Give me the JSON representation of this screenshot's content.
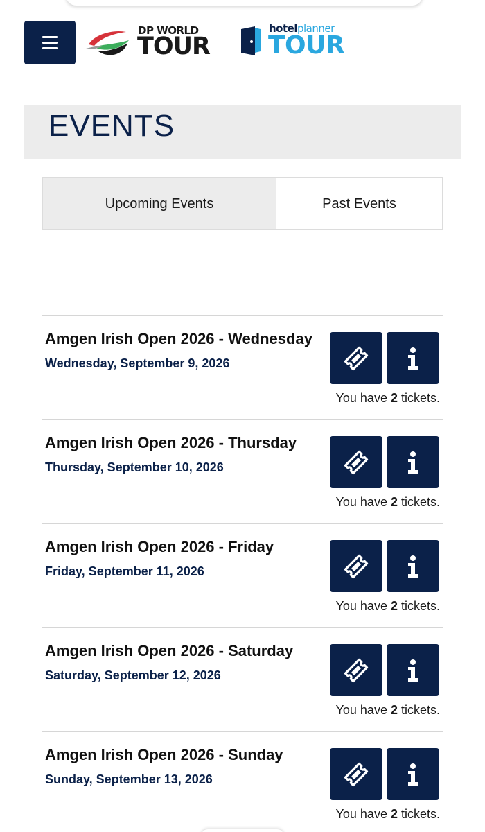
{
  "logos": {
    "dp_world_small": "DP WORLD",
    "dp_world_big": "TOUR",
    "hotelplanner_small_bold": "hotel",
    "hotelplanner_small_light": "planner",
    "hotelplanner_big": "TOUR"
  },
  "page_title": "EVENTS",
  "tabs": [
    {
      "label": "Upcoming Events"
    },
    {
      "label": "Past Events"
    }
  ],
  "colors": {
    "navy": "#0b2149",
    "light_blue": "#2aa7df",
    "banner_gray": "#ececec"
  },
  "icons": {
    "menu": "hamburger-icon",
    "ticket": "ticket-icon",
    "info": "info-icon"
  },
  "events": [
    {
      "title": "Amgen Irish Open 2026 - Wednesday",
      "date": "Wednesday, September 9, 2026",
      "tickets_prefix": "You have ",
      "tickets_count": "2",
      "tickets_suffix": " tickets."
    },
    {
      "title": "Amgen Irish Open 2026 - Thursday",
      "date": "Thursday, September 10, 2026",
      "tickets_prefix": "You have ",
      "tickets_count": "2",
      "tickets_suffix": " tickets."
    },
    {
      "title": "Amgen Irish Open 2026 - Friday",
      "date": "Friday, September 11, 2026",
      "tickets_prefix": "You have ",
      "tickets_count": "2",
      "tickets_suffix": " tickets."
    },
    {
      "title": "Amgen Irish Open 2026 - Saturday",
      "date": "Saturday, September 12, 2026",
      "tickets_prefix": "You have ",
      "tickets_count": "2",
      "tickets_suffix": " tickets."
    },
    {
      "title": "Amgen Irish Open 2026 - Sunday",
      "date": "Sunday, September 13, 2026",
      "tickets_prefix": "You have ",
      "tickets_count": "2",
      "tickets_suffix": " tickets."
    }
  ]
}
